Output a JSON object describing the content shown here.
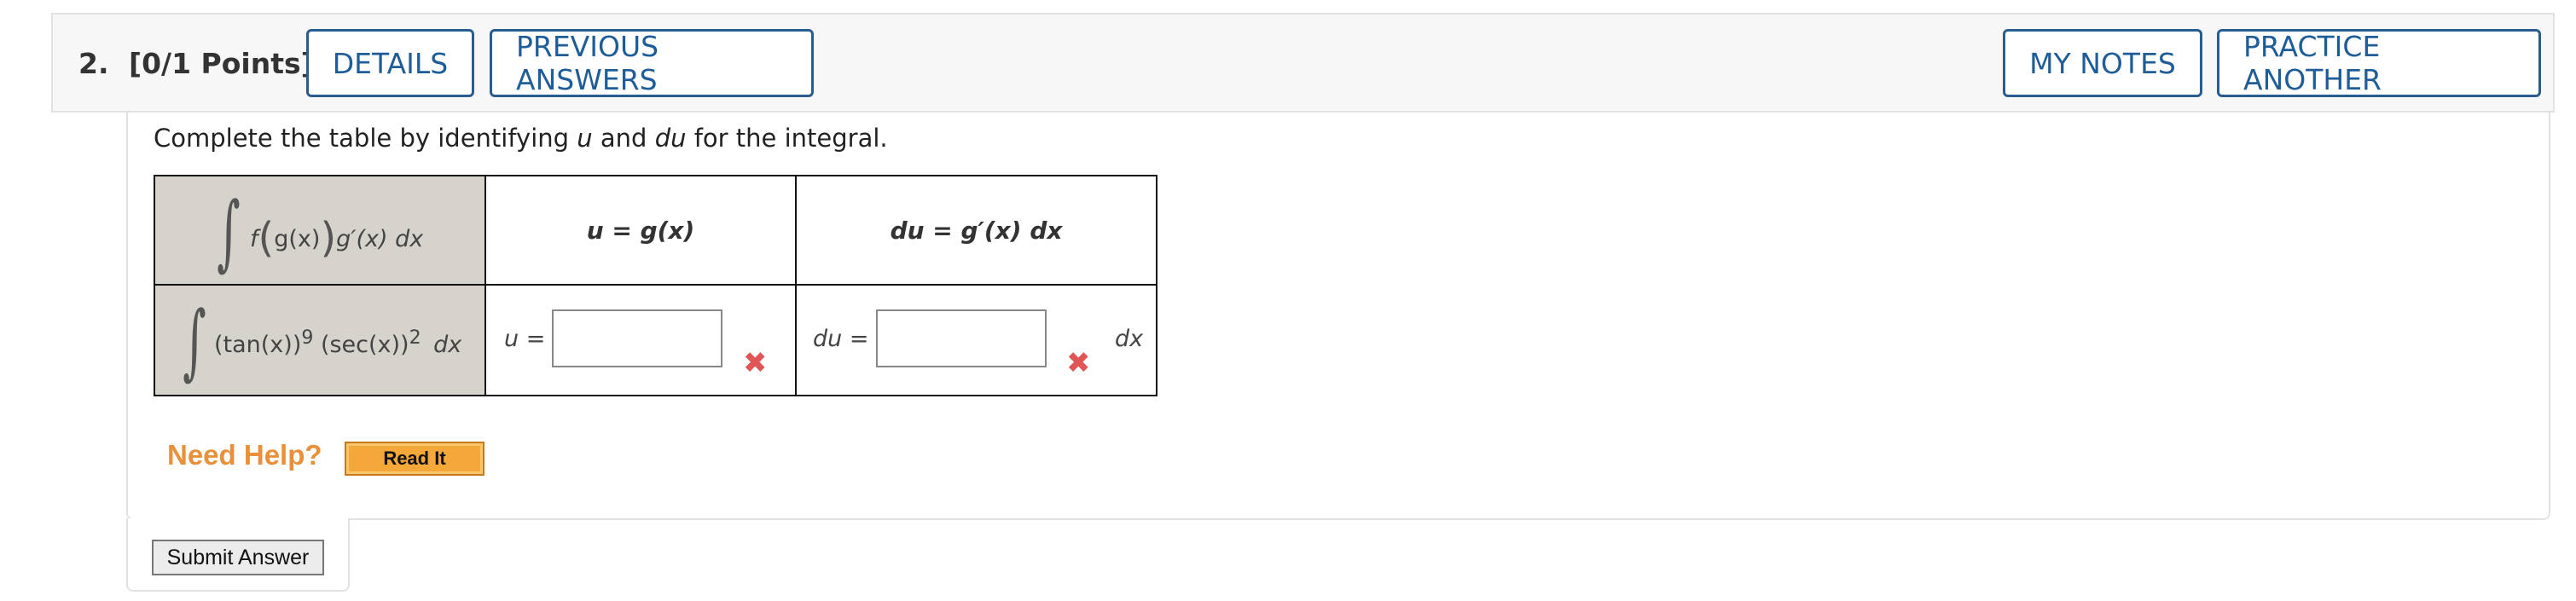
{
  "question": {
    "number": "2.",
    "points": "[0/1 Points]",
    "details_label": "DETAILS",
    "previous_answers_label": "PREVIOUS ANSWERS",
    "my_notes_label": "MY NOTES",
    "practice_another_label": "PRACTICE ANOTHER"
  },
  "instruction": {
    "pre": "Complete the table by identifying ",
    "u": "u",
    "mid": " and ",
    "du": "du",
    "post": " for the integral."
  },
  "table": {
    "header_integral": {
      "f": "f",
      "gx": "g(x)",
      "rest": "g′(x) dx"
    },
    "header_u": "u = g(x)",
    "header_du": "du = g′(x) dx",
    "integral_tan": "(tan(x))",
    "integral_tan_exp": "9",
    "integral_sec": " (sec(x))",
    "integral_sec_exp": "2",
    "integral_dx": "dx",
    "u_label": "u =",
    "u_value": "",
    "du_label": "du =",
    "du_value": "",
    "dx_suffix": "dx",
    "u_status": "incorrect",
    "du_status": "incorrect"
  },
  "help": {
    "need_help": "Need Help?",
    "read_it": "Read It"
  },
  "submit_label": "Submit Answer",
  "colors": {
    "button_border": "#2a5d8f",
    "button_text": "#1f5d99",
    "need_help": "#e8913a",
    "incorrect": "#e05555",
    "cell_gray": "#d6d2cc"
  }
}
